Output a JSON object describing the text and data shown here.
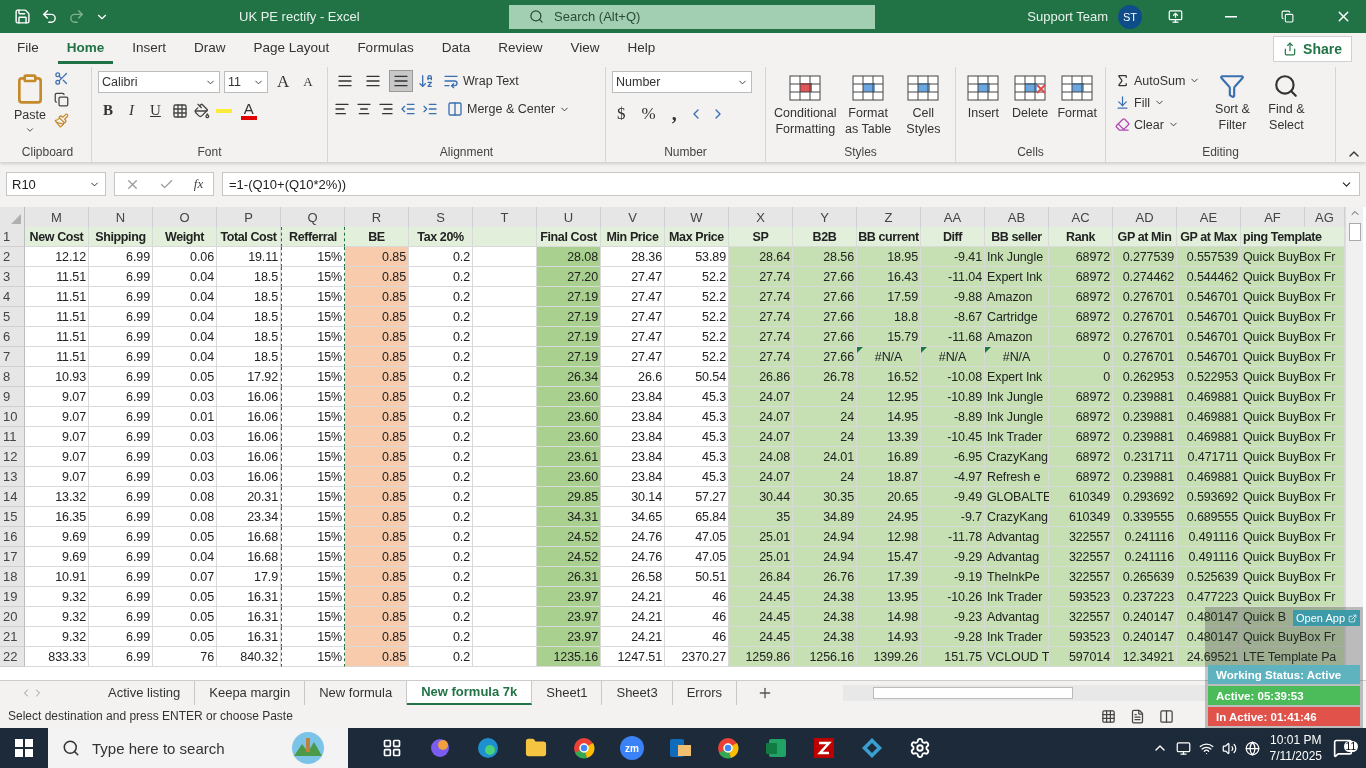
{
  "window": {
    "title": "UK PE rectify  -  Excel",
    "search": {
      "placeholder": "Search (Alt+Q)"
    },
    "user": "Support Team",
    "avatar": "ST"
  },
  "menu": {
    "tabs": [
      {
        "label": "File",
        "selected": false
      },
      {
        "label": "Home",
        "selected": true
      },
      {
        "label": "Insert",
        "selected": false
      },
      {
        "label": "Draw",
        "selected": false
      },
      {
        "label": "Page Layout",
        "selected": false
      },
      {
        "label": "Formulas",
        "selected": false
      },
      {
        "label": "Data",
        "selected": false
      },
      {
        "label": "Review",
        "selected": false
      },
      {
        "label": "View",
        "selected": false
      },
      {
        "label": "Help",
        "selected": false
      }
    ],
    "share": "Share"
  },
  "ribbon": [
    {
      "kind": "clipboard",
      "label": "Clipboard",
      "paste": "Paste"
    },
    {
      "kind": "font",
      "label": "Font",
      "font": "Calibri",
      "size": "11",
      "grow": "A",
      "shrink": "A",
      "bold": "B",
      "italic": "I",
      "underline": "U",
      "font_color": "A"
    },
    {
      "kind": "alignment",
      "label": "Alignment",
      "vertical_align": [
        {
          "selected": false
        },
        {
          "selected": false
        },
        {
          "selected": true
        }
      ],
      "wrap": "Wrap Text",
      "merge": "Merge & Center"
    },
    {
      "kind": "number",
      "label": "Number",
      "format": "Number",
      "currency": "$",
      "percent": "%",
      "comma": ","
    },
    {
      "kind": "styles",
      "label": "Styles",
      "buttons": [
        "Conditional Formatting",
        "Format as Table",
        "Cell Styles"
      ]
    },
    {
      "kind": "cells",
      "label": "Cells",
      "buttons": [
        "Insert",
        "Delete",
        "Format"
      ]
    },
    {
      "kind": "editing",
      "label": "Editing",
      "autosum": "AutoSum",
      "fill": "Fill",
      "clear": "Clear",
      "buttons": [
        "Sort & Filter",
        "Find & Select"
      ]
    }
  ],
  "formula_bar": {
    "name_box": "R10",
    "fx": "fx",
    "formula": "=1-(Q10+(Q10*2%))"
  },
  "sheet": {
    "columns": [
      {
        "letter": "M",
        "header": "New Cost",
        "kind": "number",
        "marquee": false
      },
      {
        "letter": "N",
        "header": "Shipping",
        "kind": "number",
        "marquee": false
      },
      {
        "letter": "O",
        "header": "Weight",
        "kind": "number",
        "marquee": false
      },
      {
        "letter": "P",
        "header": "Total Cost",
        "kind": "number",
        "marquee": false
      },
      {
        "letter": "Q",
        "header": "Refferral",
        "kind": "number",
        "marquee": true
      },
      {
        "letter": "R",
        "header": "BE",
        "kind": "number",
        "marquee": false,
        "color": "#f8cbad"
      },
      {
        "letter": "S",
        "header": "Tax 20%",
        "kind": "number",
        "marquee": false
      },
      {
        "letter": "T",
        "kind": "number",
        "marquee": false
      },
      {
        "letter": "U",
        "header": "Final Cost",
        "kind": "number",
        "marquee": false,
        "color": "#a9d08e"
      },
      {
        "letter": "V",
        "header": "Min Price",
        "kind": "number",
        "marquee": false
      },
      {
        "letter": "W",
        "header": "Max Price",
        "kind": "number",
        "marquee": false
      },
      {
        "letter": "X",
        "header": "SP",
        "kind": "number",
        "marquee": false,
        "color": "#c6e0b4"
      },
      {
        "letter": "Y",
        "header": "B2B",
        "kind": "number",
        "marquee": false,
        "color": "#c6e0b4"
      },
      {
        "letter": "Z",
        "header": "BB current",
        "kind": "ref",
        "marquee": false,
        "color": "#c6e0b4"
      },
      {
        "letter": "AA",
        "header": "Diff",
        "kind": "ref",
        "marquee": false,
        "color": "#c6e0b4"
      },
      {
        "letter": "AB",
        "header": "BB seller",
        "kind": "reftext",
        "marquee": false,
        "color": "#c6e0b4"
      },
      {
        "letter": "AC",
        "header": "Rank",
        "kind": "number",
        "marquee": false,
        "color": "#c6e0b4"
      },
      {
        "letter": "AD",
        "header": "GP at Min",
        "kind": "number",
        "marquee": false,
        "color": "#c6e0b4"
      },
      {
        "letter": "AE",
        "header": "GP at Max",
        "kind": "number",
        "marquee": false,
        "color": "#c6e0b4"
      },
      {
        "letter": "AF",
        "header": "ping Template",
        "kind": "text",
        "marquee": false,
        "color": "#c6e0b4"
      }
    ],
    "partial_column": "AG",
    "header_row": "1",
    "rows": [
      {
        "n": "2",
        "flagged": false,
        "cells": [
          "12.12",
          "6.99",
          "0.06",
          "19.11",
          "15%",
          "0.85",
          "0.2",
          null,
          "28.08",
          "28.36",
          "53.89",
          "28.64",
          "28.56",
          "18.95",
          "-9.41",
          "Ink Jungle",
          "68972",
          "0.277539",
          "0.557539",
          "Quick BuyBox Fr"
        ]
      },
      {
        "n": "3",
        "flagged": false,
        "cells": [
          "11.51",
          "6.99",
          "0.04",
          "18.5",
          "15%",
          "0.85",
          "0.2",
          null,
          "27.20",
          "27.47",
          "52.2",
          "27.74",
          "27.66",
          "16.43",
          "-11.04",
          "Expert Ink",
          "68972",
          "0.274462",
          "0.544462",
          "Quick BuyBox Fr"
        ]
      },
      {
        "n": "4",
        "flagged": false,
        "cells": [
          "11.51",
          "6.99",
          "0.04",
          "18.5",
          "15%",
          "0.85",
          "0.2",
          null,
          "27.19",
          "27.47",
          "52.2",
          "27.74",
          "27.66",
          "17.59",
          "-9.88",
          "Amazon",
          "68972",
          "0.276701",
          "0.546701",
          "Quick BuyBox Fr"
        ]
      },
      {
        "n": "5",
        "flagged": false,
        "cells": [
          "11.51",
          "6.99",
          "0.04",
          "18.5",
          "15%",
          "0.85",
          "0.2",
          null,
          "27.19",
          "27.47",
          "52.2",
          "27.74",
          "27.66",
          "18.8",
          "-8.67",
          "Cartridge",
          "68972",
          "0.276701",
          "0.546701",
          "Quick BuyBox Fr"
        ]
      },
      {
        "n": "6",
        "flagged": false,
        "cells": [
          "11.51",
          "6.99",
          "0.04",
          "18.5",
          "15%",
          "0.85",
          "0.2",
          null,
          "27.19",
          "27.47",
          "52.2",
          "27.74",
          "27.66",
          "15.79",
          "-11.68",
          "Amazon",
          "68972",
          "0.276701",
          "0.546701",
          "Quick BuyBox Fr"
        ]
      },
      {
        "n": "7",
        "flagged": true,
        "cells": [
          "11.51",
          "6.99",
          "0.04",
          "18.5",
          "15%",
          "0.85",
          "0.2",
          null,
          "27.19",
          "27.47",
          "52.2",
          "27.74",
          "27.66",
          "#N/A",
          "#N/A",
          "#N/A",
          "0",
          "0.276701",
          "0.546701",
          "Quick BuyBox Fr"
        ]
      },
      {
        "n": "8",
        "flagged": false,
        "cells": [
          "10.93",
          "6.99",
          "0.05",
          "17.92",
          "15%",
          "0.85",
          "0.2",
          null,
          "26.34",
          "26.6",
          "50.54",
          "26.86",
          "26.78",
          "16.52",
          "-10.08",
          "Expert Ink",
          "0",
          "0.262953",
          "0.522953",
          "Quick BuyBox Fr"
        ]
      },
      {
        "n": "9",
        "flagged": false,
        "cells": [
          "9.07",
          "6.99",
          "0.03",
          "16.06",
          "15%",
          "0.85",
          "0.2",
          null,
          "23.60",
          "23.84",
          "45.3",
          "24.07",
          "24",
          "12.95",
          "-10.89",
          "Ink Jungle",
          "68972",
          "0.239881",
          "0.469881",
          "Quick BuyBox Fr"
        ]
      },
      {
        "n": "10",
        "flagged": false,
        "cells": [
          "9.07",
          "6.99",
          "0.01",
          "16.06",
          "15%",
          "0.85",
          "0.2",
          null,
          "23.60",
          "23.84",
          "45.3",
          "24.07",
          "24",
          "14.95",
          "-8.89",
          "Ink Jungle",
          "68972",
          "0.239881",
          "0.469881",
          "Quick BuyBox Fr"
        ]
      },
      {
        "n": "11",
        "flagged": false,
        "cells": [
          "9.07",
          "6.99",
          "0.03",
          "16.06",
          "15%",
          "0.85",
          "0.2",
          null,
          "23.60",
          "23.84",
          "45.3",
          "24.07",
          "24",
          "13.39",
          "-10.45",
          "Ink Trader",
          "68972",
          "0.239881",
          "0.469881",
          "Quick BuyBox Fr"
        ]
      },
      {
        "n": "12",
        "flagged": false,
        "cells": [
          "9.07",
          "6.99",
          "0.03",
          "16.06",
          "15%",
          "0.85",
          "0.2",
          null,
          "23.61",
          "23.84",
          "45.3",
          "24.08",
          "24.01",
          "16.89",
          "-6.95",
          "CrazyKang",
          "68972",
          "0.231711",
          "0.471711",
          "Quick BuyBox Fr"
        ]
      },
      {
        "n": "13",
        "flagged": false,
        "cells": [
          "9.07",
          "6.99",
          "0.03",
          "16.06",
          "15%",
          "0.85",
          "0.2",
          null,
          "23.60",
          "23.84",
          "45.3",
          "24.07",
          "24",
          "18.87",
          "-4.97",
          "Refresh e",
          "68972",
          "0.239881",
          "0.469881",
          "Quick BuyBox Fr"
        ]
      },
      {
        "n": "14",
        "flagged": false,
        "cells": [
          "13.32",
          "6.99",
          "0.08",
          "20.31",
          "15%",
          "0.85",
          "0.2",
          null,
          "29.85",
          "30.14",
          "57.27",
          "30.44",
          "30.35",
          "20.65",
          "-9.49",
          "GLOBALTE",
          "610349",
          "0.293692",
          "0.593692",
          "Quick BuyBox Fr"
        ]
      },
      {
        "n": "15",
        "flagged": false,
        "cells": [
          "16.35",
          "6.99",
          "0.08",
          "23.34",
          "15%",
          "0.85",
          "0.2",
          null,
          "34.31",
          "34.65",
          "65.84",
          "35",
          "34.89",
          "24.95",
          "-9.7",
          "CrazyKang",
          "610349",
          "0.339555",
          "0.689555",
          "Quick BuyBox Fr"
        ]
      },
      {
        "n": "16",
        "flagged": false,
        "cells": [
          "9.69",
          "6.99",
          "0.05",
          "16.68",
          "15%",
          "0.85",
          "0.2",
          null,
          "24.52",
          "24.76",
          "47.05",
          "25.01",
          "24.94",
          "12.98",
          "-11.78",
          "Advantag",
          "322557",
          "0.241116",
          "0.491116",
          "Quick BuyBox Fr"
        ]
      },
      {
        "n": "17",
        "flagged": false,
        "cells": [
          "9.69",
          "6.99",
          "0.04",
          "16.68",
          "15%",
          "0.85",
          "0.2",
          null,
          "24.52",
          "24.76",
          "47.05",
          "25.01",
          "24.94",
          "15.47",
          "-9.29",
          "Advantag",
          "322557",
          "0.241116",
          "0.491116",
          "Quick BuyBox Fr"
        ]
      },
      {
        "n": "18",
        "flagged": false,
        "cells": [
          "10.91",
          "6.99",
          "0.07",
          "17.9",
          "15%",
          "0.85",
          "0.2",
          null,
          "26.31",
          "26.58",
          "50.51",
          "26.84",
          "26.76",
          "17.39",
          "-9.19",
          "TheInkPe",
          "322557",
          "0.265639",
          "0.525639",
          "Quick BuyBox Fr"
        ]
      },
      {
        "n": "19",
        "flagged": false,
        "cells": [
          "9.32",
          "6.99",
          "0.05",
          "16.31",
          "15%",
          "0.85",
          "0.2",
          null,
          "23.97",
          "24.21",
          "46",
          "24.45",
          "24.38",
          "13.95",
          "-10.26",
          "Ink Trader",
          "593523",
          "0.237223",
          "0.477223",
          "Quick BuyBox Fr"
        ]
      },
      {
        "n": "20",
        "flagged": false,
        "cells": [
          "9.32",
          "6.99",
          "0.05",
          "16.31",
          "15%",
          "0.85",
          "0.2",
          null,
          "23.97",
          "24.21",
          "46",
          "24.45",
          "24.38",
          "14.98",
          "-9.23",
          "Advantag",
          "322557",
          "0.240147",
          "0.480147",
          "Quick B"
        ]
      },
      {
        "n": "21",
        "flagged": false,
        "cells": [
          "9.32",
          "6.99",
          "0.05",
          "16.31",
          "15%",
          "0.85",
          "0.2",
          null,
          "23.97",
          "24.21",
          "46",
          "24.45",
          "24.38",
          "14.93",
          "-9.28",
          "Ink Trader",
          "593523",
          "0.240147",
          "0.480147",
          "Quick BuyBox Fr"
        ]
      },
      {
        "n": "22",
        "flagged": false,
        "cells": [
          "833.33",
          "6.99",
          "76",
          "840.32",
          "15%",
          "0.85",
          "0.2",
          null,
          "1235.16",
          "1247.51",
          "2370.27",
          "1259.86",
          "1256.16",
          "1399.26",
          "151.75",
          "VCLOUD T",
          "597014",
          "12.34921",
          "24.69521",
          "LTE Template Pa"
        ]
      }
    ]
  },
  "sheet_tabs": [
    {
      "label": "Active listing",
      "selected": false
    },
    {
      "label": "Keepa margin",
      "selected": false
    },
    {
      "label": "New formula",
      "selected": false
    },
    {
      "label": "New formula 7k",
      "selected": true
    },
    {
      "label": "Sheet1",
      "selected": false
    },
    {
      "label": "Sheet3",
      "selected": false
    },
    {
      "label": "Errors",
      "selected": false
    }
  ],
  "status_bar": {
    "message": "Select destination and press ENTER or choose Paste"
  },
  "tracker": {
    "open": "Open App",
    "status": "Working Status: Active",
    "active": "Active: 05:39:53",
    "inactive": "In Active: 01:41:46"
  },
  "taskbar": {
    "search": {
      "placeholder": "Type here to search"
    },
    "apps": [
      {
        "kind": "taskview"
      },
      {
        "kind": "copilot"
      },
      {
        "kind": "edge"
      },
      {
        "kind": "explorer"
      },
      {
        "kind": "chrome"
      },
      {
        "kind": "zoom",
        "glyph": "zm"
      },
      {
        "kind": "outlook"
      },
      {
        "kind": "chrome"
      },
      {
        "kind": "excel"
      },
      {
        "kind": "filezilla"
      },
      {
        "kind": "diamond"
      },
      {
        "kind": "settings"
      }
    ],
    "time": "10:01 PM",
    "date": "7/11/2025",
    "notifications": "11"
  }
}
